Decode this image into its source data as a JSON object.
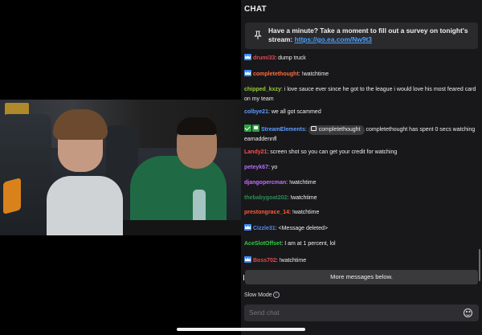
{
  "chat": {
    "header": "CHAT",
    "pinned": {
      "text": "Have a minute? Take a moment to fill out a survey on tonight's stream: ",
      "link": "https://go.ea.com/Nw9t3"
    },
    "messages": [
      {
        "badges": [
          "crown"
        ],
        "user": "drumi33",
        "color": "#e5484d",
        "sep": ": ",
        "text": "dump truck"
      },
      {
        "badges": [
          "crown"
        ],
        "user": "completethought",
        "color": "#ff6a3d",
        "sep": ": ",
        "text": "!watchtime"
      },
      {
        "badges": [],
        "user": "chipped_kxzy",
        "color": "#9acd32",
        "sep": ": ",
        "text": "i love sauce ever since he got to the league i would love his most feared card on my team"
      },
      {
        "badges": [],
        "user": "colbye21",
        "color": "#5c9dff",
        "sep": ": ",
        "text": "we all got scammed"
      },
      {
        "badges": [
          "check",
          "robot"
        ],
        "user": "StreamElements",
        "color": "#5c9dff",
        "sep": ": ",
        "chip": "completethought",
        "text": "completethought has spent 0 secs watching eamaddennfl"
      },
      {
        "badges": [],
        "user": "Landy21",
        "color": "#ff4f4f",
        "sep": ": ",
        "text": "screen shot so you can get your credit for watching"
      },
      {
        "badges": [],
        "user": "peteyk67",
        "color": "#b46cff",
        "sep": ": ",
        "text": "yo"
      },
      {
        "badges": [],
        "user": "djangopercman",
        "color": "#c96bff",
        "sep": ": ",
        "text": "!watchtime"
      },
      {
        "badges": [],
        "user": "thebabygoat202",
        "color": "#2e8b57",
        "sep": ": ",
        "text": "!watchtime"
      },
      {
        "badges": [],
        "user": "prestongrace_14",
        "color": "#ff5a36",
        "sep": ": ",
        "text": "!watchtime"
      },
      {
        "badges": [
          "crown"
        ],
        "user": "Cizzle31",
        "color": "#4f8cff",
        "sep": ": ",
        "text": "<Message deleted>"
      },
      {
        "badges": [],
        "user": "AceSlotOffset",
        "color": "#2ecc40",
        "sep": ": ",
        "text": "I am at 1 percent, lol"
      },
      {
        "badges": [
          "crown"
        ],
        "user": "Boss702",
        "color": "#e5484d",
        "sep": ": ",
        "text": "!watchtime"
      }
    ],
    "more_messages": "More messages below.",
    "slow_mode": "Slow Mode",
    "info_glyph": "i",
    "input_placeholder": "Send chat"
  }
}
